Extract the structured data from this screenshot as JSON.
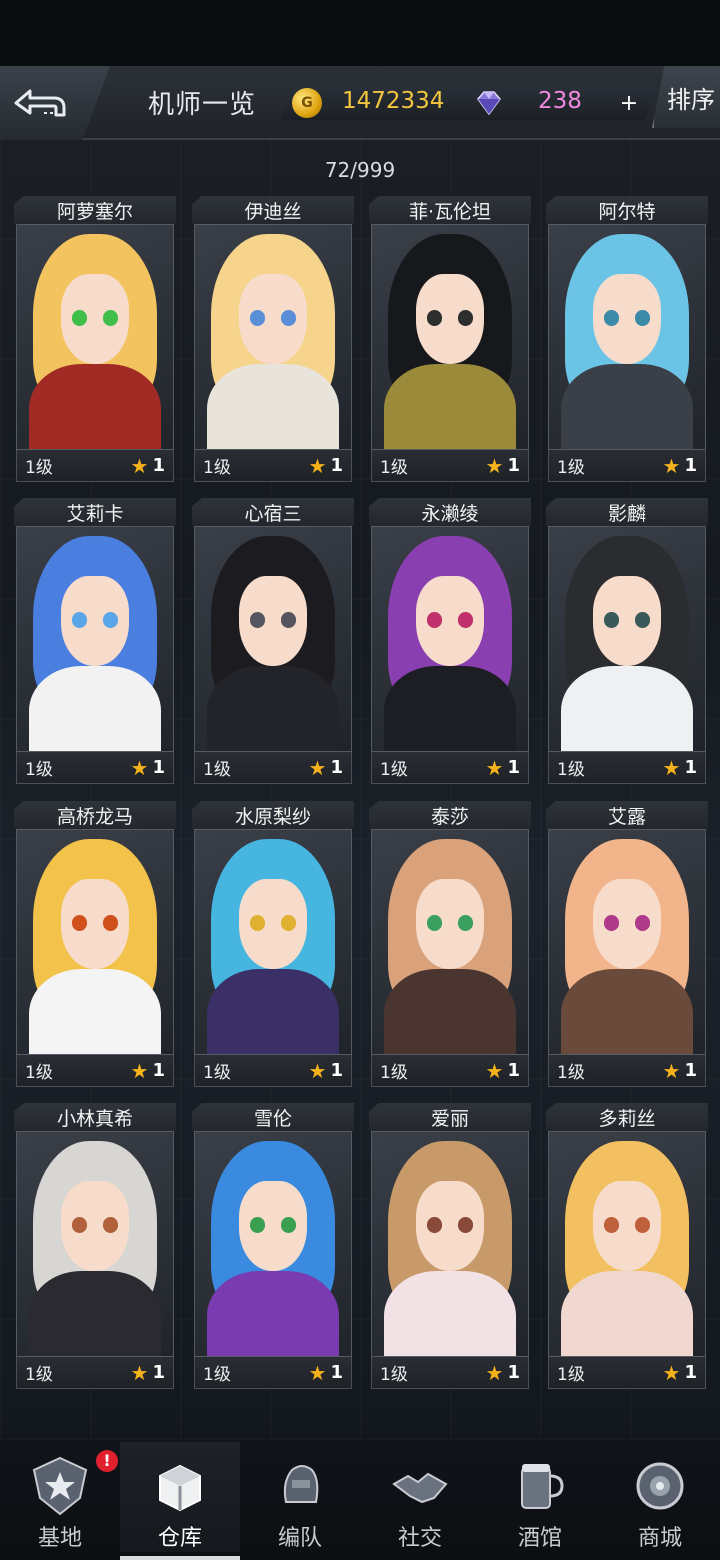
{
  "header": {
    "title": "机师一览",
    "coins": "1472334",
    "gems": "238",
    "plus": "+",
    "sort_label": "排序"
  },
  "count_text": "72/999",
  "pilots": [
    {
      "name": "阿萝塞尔",
      "level": "1级",
      "stars": "1",
      "hair": "#f2c35e",
      "eye": "#3fbf4a",
      "outfit": "#a22a25"
    },
    {
      "name": "伊迪丝",
      "level": "1级",
      "stars": "1",
      "hair": "#f6d48c",
      "eye": "#5a8fd8",
      "outfit": "#e8e4dc"
    },
    {
      "name": "菲·瓦伦坦",
      "level": "1级",
      "stars": "1",
      "hair": "#16181c",
      "eye": "#2e2e2e",
      "outfit": "#9b8a3a"
    },
    {
      "name": "阿尔特",
      "level": "1级",
      "stars": "1",
      "hair": "#6bc3e6",
      "eye": "#3a8aa8",
      "outfit": "#3b3f48"
    },
    {
      "name": "艾莉卡",
      "level": "1级",
      "stars": "1",
      "hair": "#4a7fe0",
      "eye": "#5aa4e8",
      "outfit": "#f2f2f2"
    },
    {
      "name": "心宿三",
      "level": "1级",
      "stars": "1",
      "hair": "#1c1c20",
      "eye": "#555560",
      "outfit": "#22242a"
    },
    {
      "name": "永濑绫",
      "level": "1级",
      "stars": "1",
      "hair": "#8a3fb0",
      "eye": "#c0306a",
      "outfit": "#1d1e24"
    },
    {
      "name": "影麟",
      "level": "1级",
      "stars": "1",
      "hair": "#2a2c30",
      "eye": "#3a5a5a",
      "outfit": "#eef0f2"
    },
    {
      "name": "高桥龙马",
      "level": "1级",
      "stars": "1",
      "hair": "#f2c24a",
      "eye": "#d0501c",
      "outfit": "#f4f4f4"
    },
    {
      "name": "水原梨纱",
      "level": "1级",
      "stars": "1",
      "hair": "#46b6e0",
      "eye": "#e0b030",
      "outfit": "#3a2f66"
    },
    {
      "name": "泰莎",
      "level": "1级",
      "stars": "1",
      "hair": "#d9a27a",
      "eye": "#3aa060",
      "outfit": "#4a3530"
    },
    {
      "name": "艾露",
      "level": "1级",
      "stars": "1",
      "hair": "#f2b48a",
      "eye": "#b03a8a",
      "outfit": "#6a4a3a"
    },
    {
      "name": "小林真希",
      "level": "1级",
      "stars": "1",
      "hair": "#d8d6d2",
      "eye": "#b0603a",
      "outfit": "#2a2a30"
    },
    {
      "name": "雪伦",
      "level": "1级",
      "stars": "1",
      "hair": "#3a8ae0",
      "eye": "#3aa050",
      "outfit": "#7a3ab0"
    },
    {
      "name": "爱丽",
      "level": "1级",
      "stars": "1",
      "hair": "#c89a6a",
      "eye": "#8a4a3a",
      "outfit": "#f2e2e6"
    },
    {
      "name": "多莉丝",
      "level": "1级",
      "stars": "1",
      "hair": "#f2c060",
      "eye": "#c0603a",
      "outfit": "#f0d8d0"
    }
  ],
  "nav": [
    {
      "label": "基地",
      "icon": "base-icon",
      "badge": "!"
    },
    {
      "label": "仓库",
      "icon": "warehouse-icon",
      "active": true
    },
    {
      "label": "编队",
      "icon": "formation-icon"
    },
    {
      "label": "社交",
      "icon": "social-icon"
    },
    {
      "label": "酒馆",
      "icon": "tavern-icon"
    },
    {
      "label": "商城",
      "icon": "shop-icon"
    }
  ],
  "colors": {
    "coin": "#f3c640",
    "gem": "#f08ae0",
    "star": "#f5b21b",
    "badge": "#e0202c"
  }
}
